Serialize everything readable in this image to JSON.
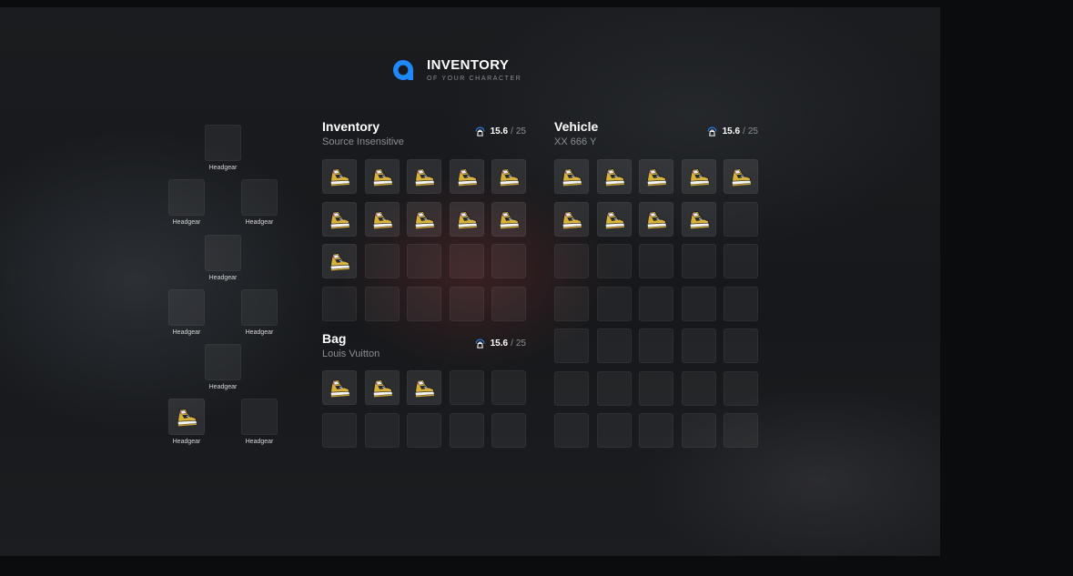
{
  "header": {
    "title": "INVENTORY",
    "subtitle": "OF YOUR CHARACTER",
    "accent": "#1e88ff"
  },
  "equipment": {
    "slots": [
      {
        "label": "Headgear",
        "item": null
      },
      {
        "label": "Headgear",
        "item": null
      },
      {
        "label": "Headgear",
        "item": null
      },
      {
        "label": "Headgear",
        "item": null
      },
      {
        "label": "Headgear",
        "item": null
      },
      {
        "label": "Headgear",
        "item": null
      },
      {
        "label": "Headgear",
        "item": null
      },
      {
        "label": "Headgear",
        "item": "sneaker-icon"
      },
      {
        "label": "Headgear",
        "item": null
      }
    ]
  },
  "inventory": {
    "title": "Inventory",
    "subtitle": "Source Insensitive",
    "weight_current": "15.6",
    "weight_separator": "/",
    "weight_max": "25",
    "filled_count": 11,
    "slot_count": 20,
    "item_icon": "sneaker-icon"
  },
  "bag": {
    "title": "Bag",
    "subtitle": "Louis Vuitton",
    "weight_current": "15.6",
    "weight_separator": "/",
    "weight_max": "25",
    "filled_count": 3,
    "slot_count": 10,
    "item_icon": "sneaker-icon"
  },
  "vehicle": {
    "title": "Vehicle",
    "subtitle": "XX 666 Y",
    "weight_current": "15.6",
    "weight_separator": "/",
    "weight_max": "25",
    "filled_count": 9,
    "slot_count": 35,
    "item_icon": "sneaker-icon"
  }
}
